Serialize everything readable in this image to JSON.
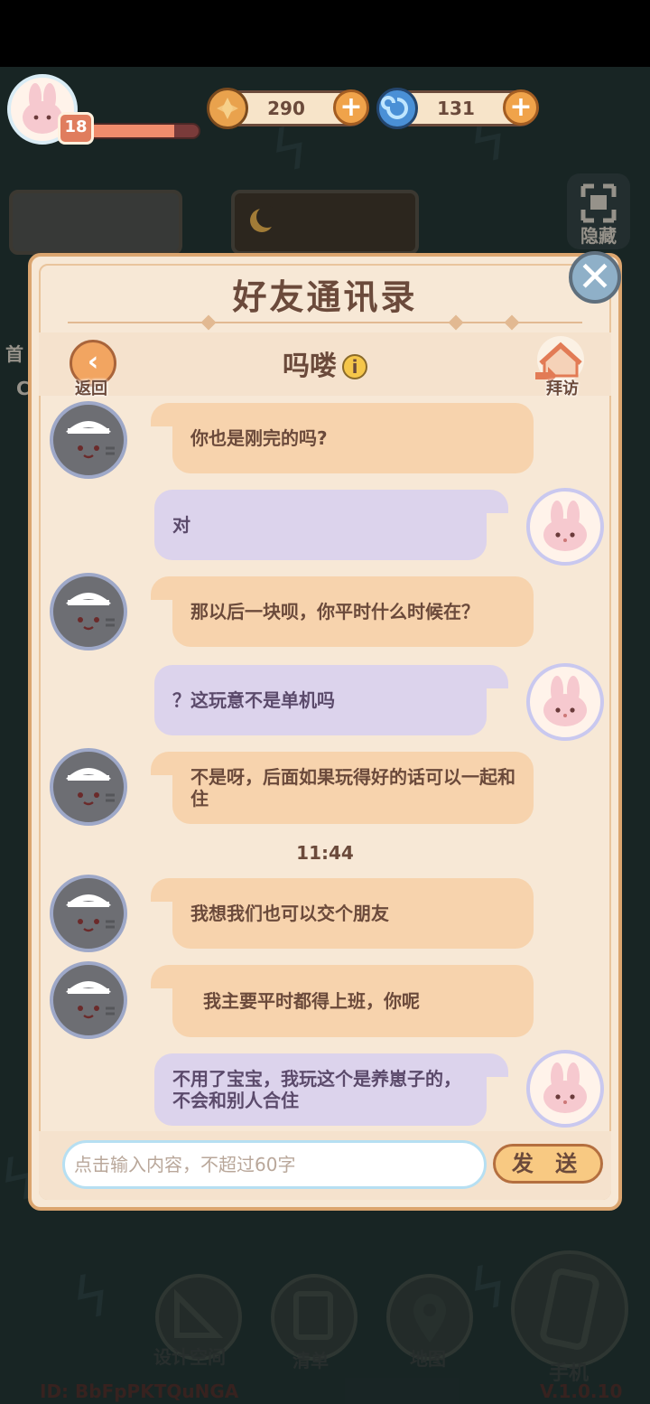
{
  "hud": {
    "level": "18",
    "xp_progress": 0.78,
    "coins": "290",
    "gems": "131",
    "hide_button": "隐藏",
    "left_peek_1": "首",
    "left_peek_2": "C"
  },
  "dialog": {
    "title": "好友通讯录",
    "back_label": "返回",
    "visit_label": "拜访",
    "friend_name": "吗喽",
    "info_icon_glyph": "i",
    "close_glyph": "✕",
    "messages": [
      {
        "side": "left",
        "text": "你也是刚完的吗?"
      },
      {
        "side": "right",
        "text": "对"
      },
      {
        "side": "left",
        "text": "那以后一块呗，你平时什么时候在？"
      },
      {
        "side": "right",
        "text": "？这玩意不是单机吗"
      },
      {
        "side": "left",
        "text": "不是呀，后面如果玩得好的话可以一起和住"
      },
      {
        "side": "left",
        "text": "我想我们也可以交个朋友"
      },
      {
        "side": "left",
        "text": "我主要平时都得上班，你呢"
      },
      {
        "side": "right",
        "text": "不用了宝宝，我玩这个是养崽子的，不会和别人合住"
      }
    ],
    "timestamp": "11:44",
    "input_placeholder": "点击输入内容，不超过60字",
    "send_label": "发 送"
  },
  "bottom_nav": {
    "design": "设计空间",
    "list": "清单",
    "map": "地图",
    "phone": "手机"
  },
  "footer": {
    "id_text": "ID: BbFpPKTQuNGA",
    "version": "V.1.0.10"
  },
  "icons": {
    "coin": "coin-icon",
    "gem": "swirl-gem-icon",
    "plus": "plus-icon",
    "close": "close-icon",
    "back": "chevron-left-icon",
    "visit": "house-icon",
    "info": "info-icon"
  },
  "colors": {
    "panel": "#f7e8d6",
    "panel_border": "#dba56f",
    "left_bubble": "#f7d3ad",
    "right_bubble": "#dcd3ec",
    "text_brown": "#6b4a3b",
    "send_button": "#f8c982"
  }
}
